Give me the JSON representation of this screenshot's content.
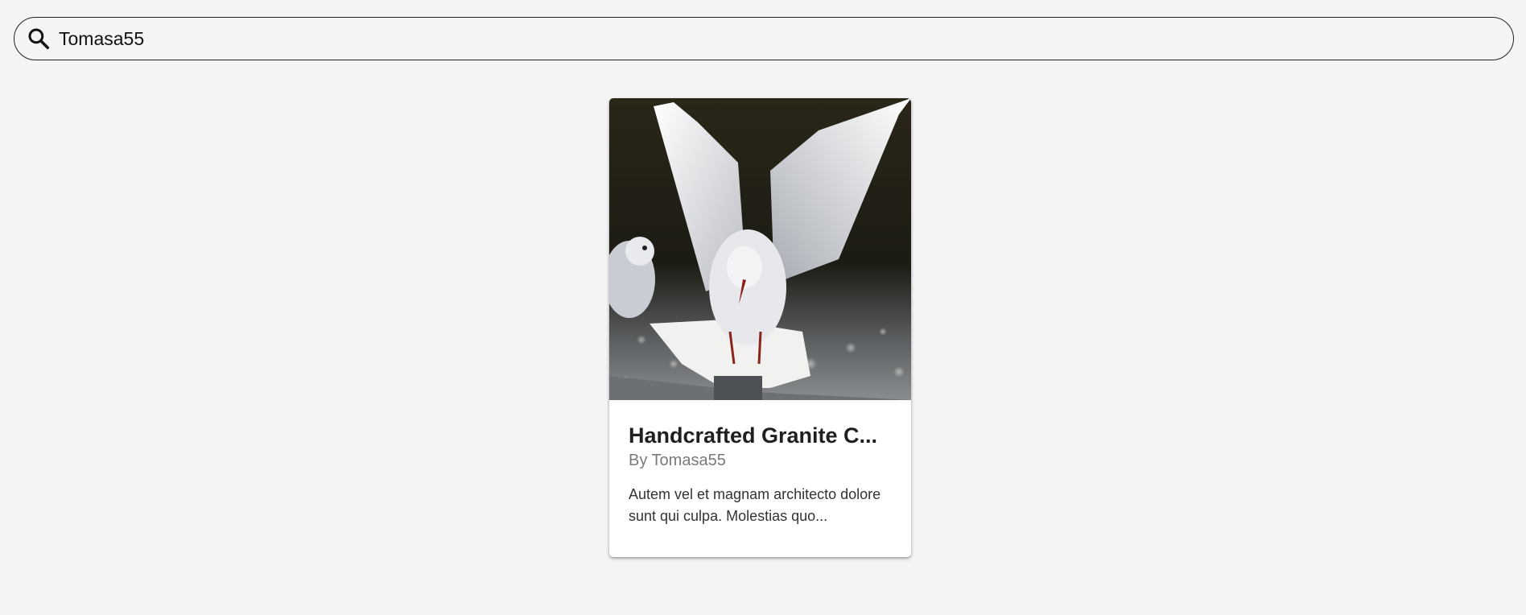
{
  "search": {
    "icon": "search-icon",
    "value": "Tomasa55"
  },
  "results": [
    {
      "image": "seagull-photo",
      "title": "Handcrafted Granite C...",
      "author": "By Tomasa55",
      "description": "Autem vel et magnam architecto dolore sunt qui culpa. Molestias quo..."
    }
  ]
}
